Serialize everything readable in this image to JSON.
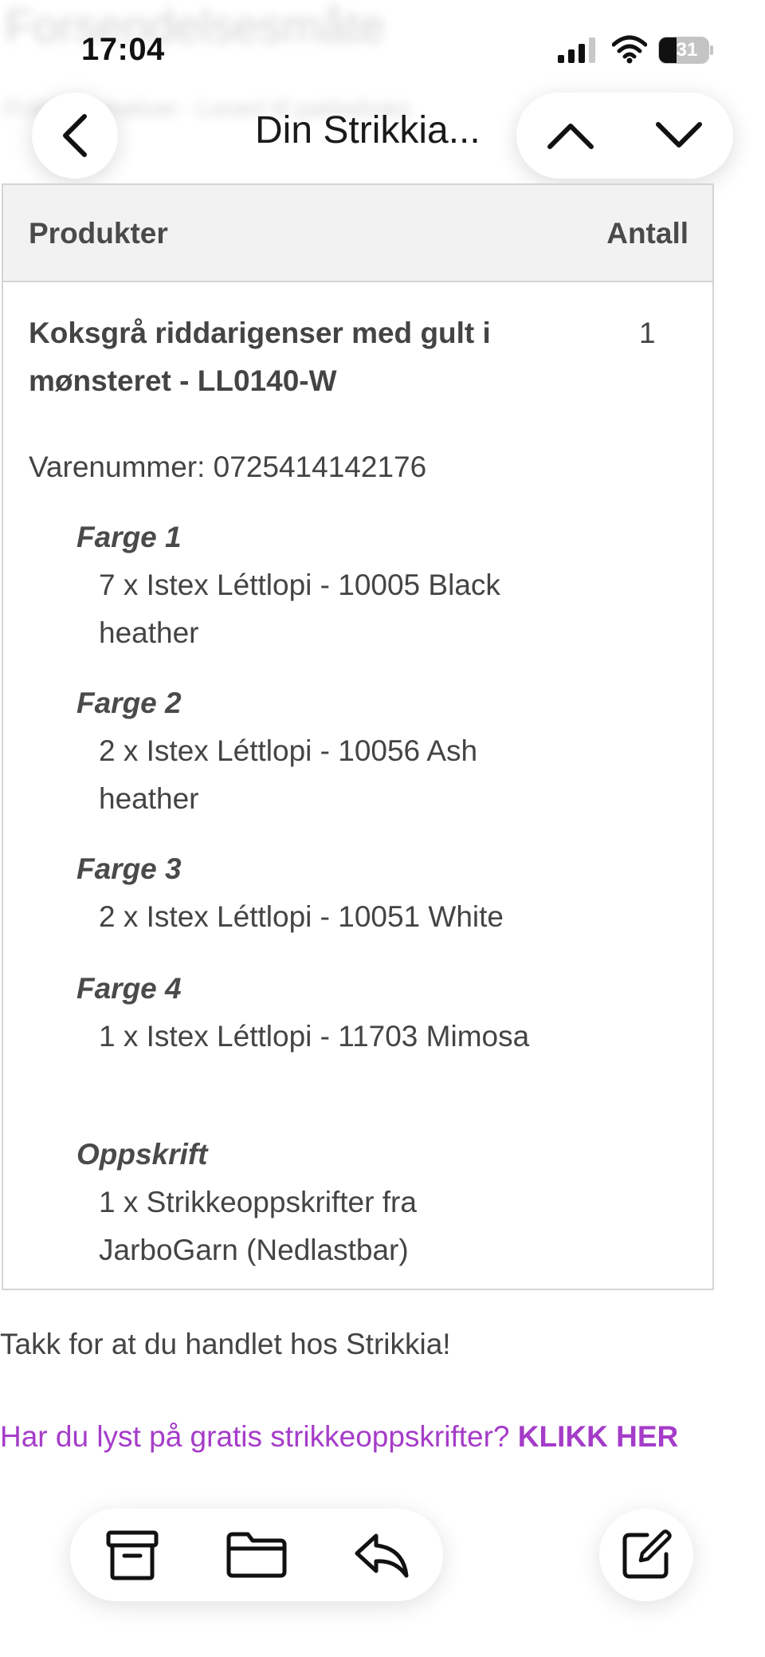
{
  "background_header": {
    "title": "Forsendelsesmåte",
    "subtitle": "Fraktalternativer - Levert til pakkeboks"
  },
  "status_bar": {
    "time": "17:04",
    "battery": "31",
    "icons": [
      "signal-icon",
      "wifi-icon",
      "battery-icon"
    ]
  },
  "nav": {
    "back_icon": "chevron-left-icon",
    "title": "Din Strikkia...",
    "prev_icon": "chevron-up-icon",
    "next_icon": "chevron-down-icon"
  },
  "table": {
    "headers": {
      "products": "Produkter",
      "quantity": "Antall"
    },
    "product": {
      "name": "Koksgrå riddarigenser med gult i mønsteret - LL0140-W",
      "quantity": "1",
      "sku": "Varenummer: 0725414142176",
      "options": [
        {
          "label": "Farge 1",
          "value": "7 x Istex Léttlopi - 10005 Black heather"
        },
        {
          "label": "Farge 2",
          "value": "2 x Istex Léttlopi - 10056 Ash heather"
        },
        {
          "label": "Farge 3",
          "value": "2 x Istex Léttlopi - 10051 White"
        },
        {
          "label": "Farge 4",
          "value": "1 x Istex Léttlopi - 11703 Mimosa"
        },
        {
          "label": "Oppskrift",
          "value": "1 x Strikkeoppskrifter fra JarboGarn (Nedlastbar)"
        }
      ]
    }
  },
  "footer": {
    "thanks": "Takk for at du handlet hos Strikkia!",
    "promo_text": "Har du lyst på gratis strikkeoppskrifter? ",
    "promo_link": "KLIKK HER"
  },
  "toolbar": {
    "icons": [
      "archive-icon",
      "folder-icon",
      "reply-icon",
      "compose-icon"
    ]
  },
  "colors": {
    "link": "#a53cc9",
    "table_header_bg": "#f2f2f2",
    "border": "#d4d4d4"
  }
}
